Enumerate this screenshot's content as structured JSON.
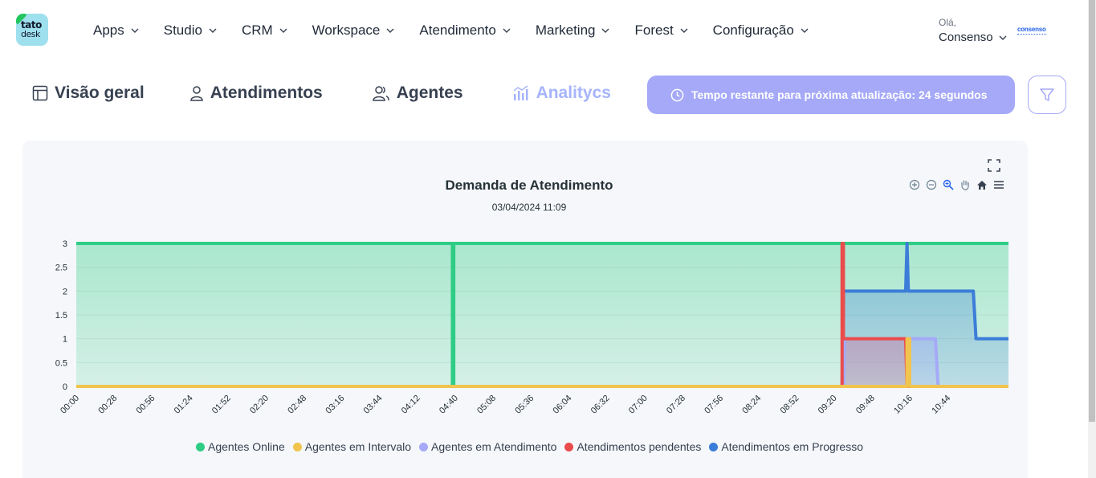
{
  "logo": {
    "line1": "tato",
    "line2": "desk"
  },
  "nav": [
    {
      "label": "Apps"
    },
    {
      "label": "Studio"
    },
    {
      "label": "CRM"
    },
    {
      "label": "Workspace"
    },
    {
      "label": "Atendimento"
    },
    {
      "label": "Marketing"
    },
    {
      "label": "Forest"
    },
    {
      "label": "Configuração"
    }
  ],
  "user": {
    "greeting": "Olá,",
    "name": "Consenso"
  },
  "brand": {
    "text": "consenso"
  },
  "tabs": [
    {
      "label": "Visão geral",
      "icon": "layout-icon"
    },
    {
      "label": "Atendimentos",
      "icon": "user-icon"
    },
    {
      "label": "Agentes",
      "icon": "users-icon"
    },
    {
      "label": "Analitycs",
      "icon": "bar-chart-icon",
      "active": true
    }
  ],
  "timer": {
    "text": "Tempo restante para próxima atualização: 24 segundos"
  },
  "colors": {
    "accent": "#a5a9f7",
    "online": "#2ecc85",
    "intervalo": "#f0c44f",
    "atendimento": "#a5a9f7",
    "pendentes": "#ea4c4c",
    "progresso": "#3b7dd8"
  },
  "chart_data": {
    "type": "area",
    "title": "Demanda de Atendimento",
    "subtitle": "03/04/2024 11:09",
    "ylim": [
      0,
      3
    ],
    "yticks": [
      "3",
      "2.5",
      "2",
      "1.5",
      "1",
      "0.5",
      "0"
    ],
    "xticks": [
      "00:00",
      "00:28",
      "00:56",
      "01:24",
      "01:52",
      "02:20",
      "02:48",
      "03:16",
      "03:44",
      "04:12",
      "04:40",
      "05:08",
      "05:36",
      "06:04",
      "06:32",
      "07:00",
      "07:28",
      "07:56",
      "08:24",
      "08:52",
      "09:20",
      "09:48",
      "10:16",
      "10:44"
    ],
    "x_range_minutes": [
      0,
      689
    ],
    "grid": true,
    "legend_position": "bottom",
    "series": [
      {
        "name": "Agentes Online",
        "color": "#2ecc85",
        "points": [
          [
            0,
            3
          ],
          [
            278,
            3
          ],
          [
            278,
            0
          ],
          [
            279,
            0
          ],
          [
            279,
            3
          ],
          [
            689,
            3
          ]
        ]
      },
      {
        "name": "Agentes em Intervalo",
        "color": "#f0c44f",
        "points": [
          [
            0,
            0
          ],
          [
            614,
            0
          ],
          [
            614,
            1
          ],
          [
            616,
            1
          ],
          [
            616,
            0
          ],
          [
            689,
            0
          ]
        ]
      },
      {
        "name": "Agentes em Atendimento",
        "color": "#a5a9f7",
        "points": [
          [
            0,
            0
          ],
          [
            567,
            0
          ],
          [
            568,
            1
          ],
          [
            613,
            1
          ],
          [
            614,
            1
          ],
          [
            635,
            1
          ],
          [
            637,
            0
          ],
          [
            689,
            0
          ]
        ]
      },
      {
        "name": "Atendimentos pendentes",
        "color": "#ea4c4c",
        "points": [
          [
            0,
            0
          ],
          [
            566,
            0
          ],
          [
            566,
            3
          ],
          [
            567,
            3
          ],
          [
            567,
            1
          ],
          [
            613,
            1
          ],
          [
            614,
            0
          ],
          [
            689,
            0
          ]
        ]
      },
      {
        "name": "Atendimentos em Progresso",
        "color": "#3b7dd8",
        "points": [
          [
            0,
            0
          ],
          [
            566,
            0
          ],
          [
            567,
            2
          ],
          [
            613,
            2
          ],
          [
            614,
            3
          ],
          [
            615,
            2
          ],
          [
            663,
            2
          ],
          [
            665,
            1
          ],
          [
            689,
            1
          ]
        ]
      }
    ]
  }
}
